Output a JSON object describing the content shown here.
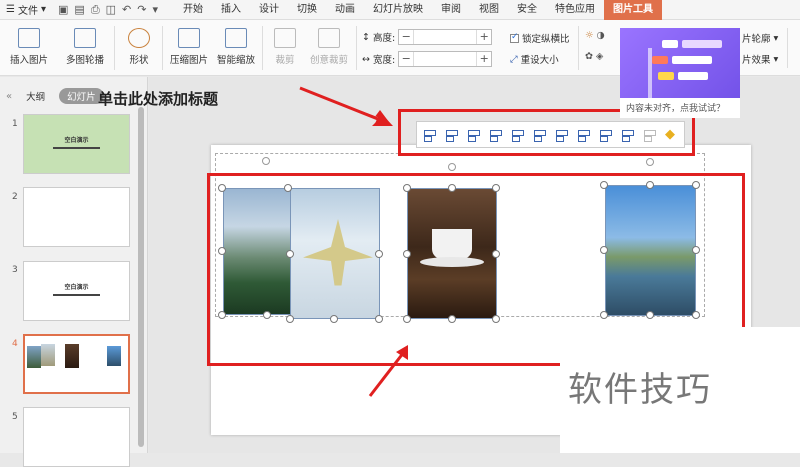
{
  "menubar": {
    "file_label": "文件",
    "tabs": [
      "开始",
      "插入",
      "设计",
      "切换",
      "动画",
      "幻灯片放映",
      "审阅",
      "视图",
      "安全",
      "特色应用",
      "图片工具"
    ],
    "active_tab": "图片工具"
  },
  "ribbon": {
    "insert_picture": "插入图片",
    "multi_crop": "多图轮播",
    "shape": "形状",
    "compress": "压缩图片",
    "smart_scale": "智能缩放",
    "crop": "裁剪",
    "creative_crop": "创意裁剪",
    "height_label": "高度:",
    "width_label": "宽度:",
    "height_value": "",
    "width_value": "",
    "lock_ratio": "锁定纵横比",
    "reset_size": "重设大小",
    "outline": "片轮廓",
    "effect": "片效果"
  },
  "panel": {
    "tab_outline": "大纲",
    "tab_slides": "幻灯片",
    "slides": [
      {
        "num": "1",
        "text": "空白演示"
      },
      {
        "num": "2",
        "text": ""
      },
      {
        "num": "3",
        "text": "空白演示"
      },
      {
        "num": "4",
        "text": ""
      },
      {
        "num": "5",
        "text": ""
      }
    ]
  },
  "slide": {
    "title": "单击此处添加标题"
  },
  "popup": {
    "text": "内容未对齐，点我试试？"
  },
  "watermark": {
    "text": "软件技巧"
  },
  "colors": {
    "accent": "#e0704a",
    "highlight": "#e02020",
    "popup": "#7b5af0"
  }
}
